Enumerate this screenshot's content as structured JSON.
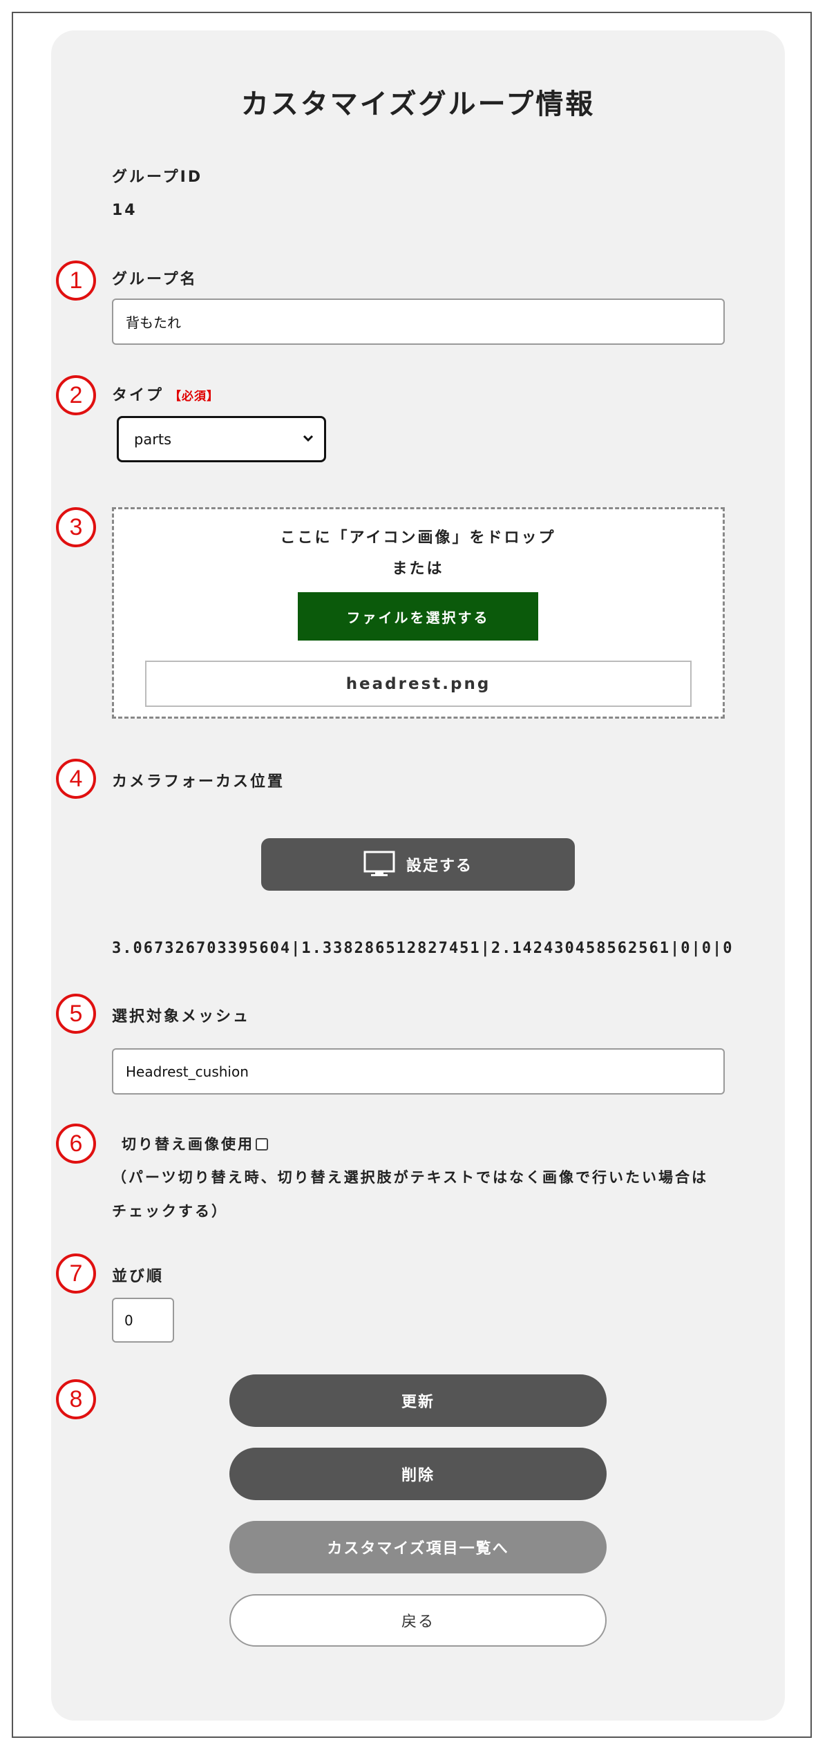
{
  "page": {
    "title": "カスタマイズグループ情報"
  },
  "markers": [
    "1",
    "2",
    "3",
    "4",
    "5",
    "6",
    "7",
    "8"
  ],
  "group_id": {
    "label": "グループID",
    "value": "14"
  },
  "group_name": {
    "label": "グループ名",
    "value": "背もたれ"
  },
  "type": {
    "label": "タイプ",
    "required": "【必須】",
    "selected": "parts"
  },
  "icon_upload": {
    "drop_text": "ここに「アイコン画像」をドロップ",
    "or_text": "または",
    "select_button": "ファイルを選択する",
    "filename": "headrest.png",
    "button_color": "#0b5a0b"
  },
  "camera_focus": {
    "label": "カメラフォーカス位置",
    "set_button": "設定する",
    "button_icon": "monitor-icon",
    "value": "3.067326703395604|1.338286512827451|2.142430458562561|0|0|0"
  },
  "mesh": {
    "label": "選択対象メッシュ",
    "value": "Headrest_cushion"
  },
  "switch_image": {
    "label": "切り替え画像使用",
    "checked": false,
    "note_line1": "（パーツ切り替え時、切り替え選択肢がテキストではなく画像で行いたい場合は",
    "note_line2": "チェックする）"
  },
  "sort_order": {
    "label": "並び順",
    "value": "0"
  },
  "actions": {
    "update": "更新",
    "delete": "削除",
    "to_list": "カスタマイズ項目一覧へ",
    "back": "戻る"
  },
  "colors": {
    "marker": "#e01010",
    "panel": "#f1f1f1",
    "dark_button": "#555555",
    "mid_button": "#8c8c8c",
    "required": "#e00000"
  }
}
